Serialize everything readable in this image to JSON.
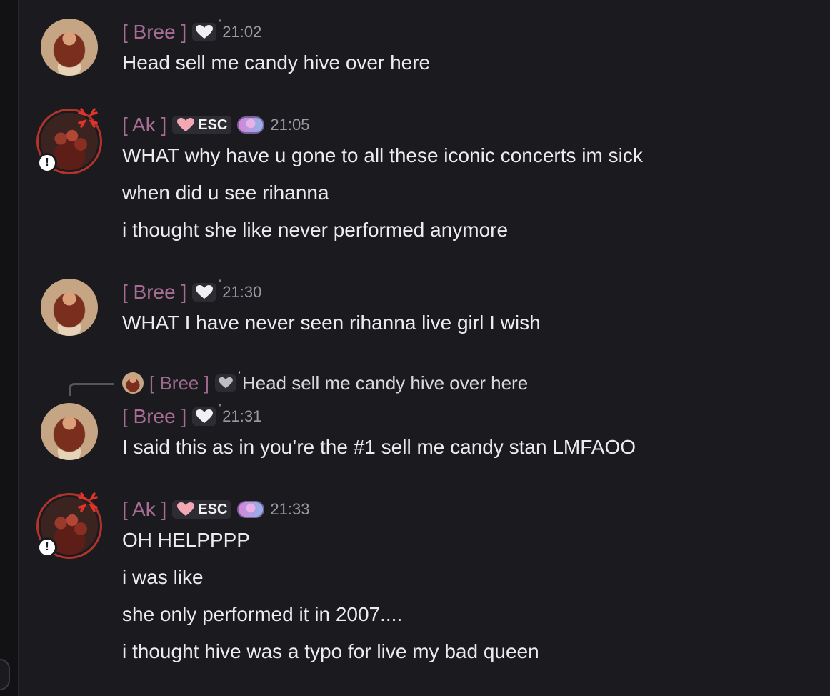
{
  "messages": [
    {
      "author": "[ Bree ]",
      "time": "21:02",
      "lines": [
        "Head sell me candy hive over here"
      ]
    },
    {
      "author": "[ Ak ]",
      "tag": "ESC",
      "time": "21:05",
      "lines": [
        "WHAT why have u gone to all these iconic concerts im sick",
        "when did u see rihanna",
        "i thought she like never performed anymore"
      ]
    },
    {
      "author": "[ Bree ]",
      "time": "21:30",
      "lines": [
        "WHAT I have never seen rihanna live girl I wish"
      ]
    },
    {
      "author": "[ Bree ]",
      "time": "21:31",
      "reply": {
        "author": "[ Bree ]",
        "text": "Head sell me candy hive over here"
      },
      "lines": [
        "I said this as in you’re the #1 sell me candy stan LMFAOO"
      ]
    },
    {
      "author": "[ Ak ]",
      "tag": "ESC",
      "time": "21:33",
      "lines": [
        "OH HELPPPP",
        "i was like",
        "she only performed it in 2007....",
        "i thought hive was a typo for live my bad queen"
      ]
    }
  ],
  "badge_symbol": "!",
  "icons": [
    "heart-icon",
    "anger-icon",
    "sparkle-badge-icon",
    "alert-status-icon"
  ]
}
